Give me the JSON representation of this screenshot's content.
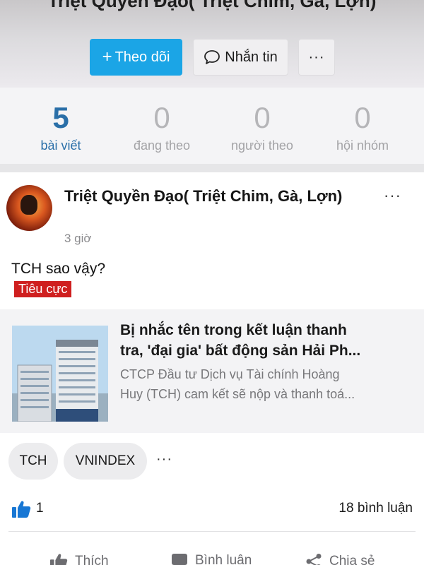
{
  "profile": {
    "name": "Triệt Quyền Đạo( Triệt Chim, Gà, Lợn)"
  },
  "header_buttons": {
    "follow": "Theo dõi",
    "message": "Nhắn tin",
    "more": "···"
  },
  "stats": [
    {
      "value": "5",
      "label": "bài viết"
    },
    {
      "value": "0",
      "label": "đang theo"
    },
    {
      "value": "0",
      "label": "người theo"
    },
    {
      "value": "0",
      "label": "hội nhóm"
    }
  ],
  "post": {
    "author": "Triệt Quyền Đạo( Triệt Chim, Gà, Lợn)",
    "time": "3 giờ",
    "menu": "···",
    "text": "TCH sao vậy?",
    "sentiment": "Tiêu cực",
    "link": {
      "title_line1": "Bị nhắc tên trong kết luận thanh",
      "title_line2": "tra, 'đại gia' bất động sản Hải Ph...",
      "desc_line1": "CTCP Đầu tư Dịch vụ Tài chính Hoàng",
      "desc_line2": "Huy (TCH) cam kết sẽ nộp và thanh toá..."
    },
    "tags": [
      "TCH",
      "VNINDEX"
    ],
    "tags_more": "···",
    "likes": "1",
    "comments": "18 bình luận"
  },
  "actions": {
    "like": "Thích",
    "comment": "Bình luận",
    "share": "Chia sẻ"
  },
  "colors": {
    "accent": "#1ba5e6",
    "active_stat": "#2a6fa8",
    "negative": "#cf1f1f",
    "like_icon": "#1877d4"
  },
  "icons": [
    "plus-icon",
    "speech-bubble-icon",
    "more-dots-icon",
    "thumbs-up-icon",
    "comment-icon",
    "share-icon"
  ]
}
